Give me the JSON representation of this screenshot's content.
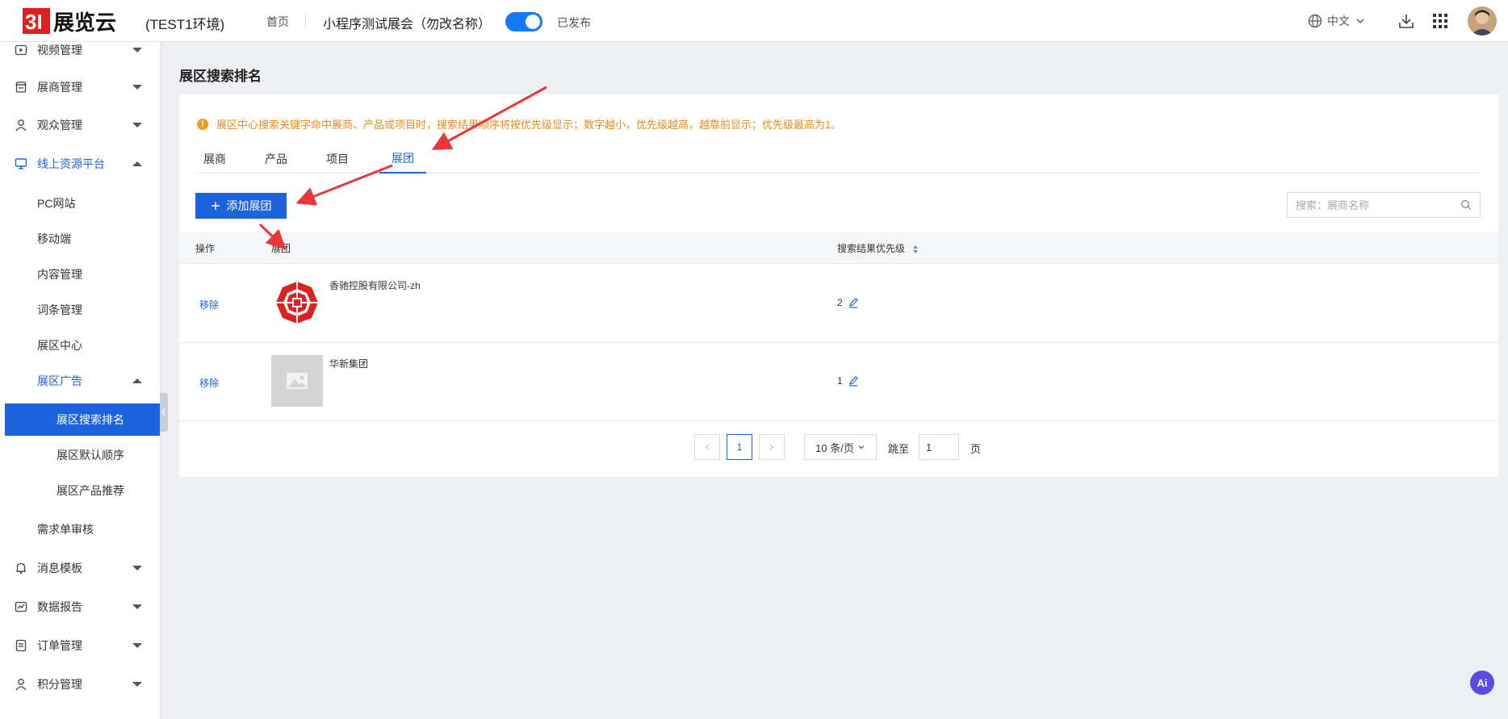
{
  "header": {
    "logo_text": "3I展览云",
    "env_label": "(TEST1环境)",
    "home_label": "首页",
    "expo_name": "小程序测试展会（勿改名称）",
    "publish_status": "已发布",
    "language": "中文"
  },
  "sidebar": {
    "items": [
      {
        "label": "视频管理",
        "icon": "video-icon",
        "state": "collapsed"
      },
      {
        "label": "展商管理",
        "icon": "shop-icon",
        "state": "collapsed"
      },
      {
        "label": "观众管理",
        "icon": "user-icon",
        "state": "collapsed"
      },
      {
        "label": "线上资源平台",
        "icon": "monitor-icon",
        "state": "expanded"
      },
      {
        "label": "PC网站"
      },
      {
        "label": "移动端"
      },
      {
        "label": "内容管理"
      },
      {
        "label": "词条管理"
      },
      {
        "label": "展区中心"
      },
      {
        "label": "展区广告",
        "state": "expanded"
      },
      {
        "label": "展区搜索排名",
        "selected": true
      },
      {
        "label": "展区默认顺序"
      },
      {
        "label": "展区产品推荐"
      },
      {
        "label": "需求单审核"
      },
      {
        "label": "消息模板",
        "icon": "bell-icon",
        "state": "collapsed"
      },
      {
        "label": "数据报告",
        "icon": "chart-icon",
        "state": "collapsed"
      },
      {
        "label": "订单管理",
        "icon": "order-icon",
        "state": "collapsed"
      },
      {
        "label": "积分管理",
        "icon": "points-icon",
        "state": "collapsed"
      }
    ]
  },
  "main": {
    "page_title": "展区搜索排名",
    "notice": "展区中心搜索关键字命中展商、产品或项目时，搜索结果顺序将按优先级显示；数字越小，优先级越高，越靠前显示；优先级最高为1。",
    "tabs": [
      {
        "label": "展商"
      },
      {
        "label": "产品"
      },
      {
        "label": "项目"
      },
      {
        "label": "展团",
        "active": true
      }
    ],
    "add_button": "添加展团",
    "search_placeholder": "搜索：展商名称",
    "table": {
      "columns": [
        "操作",
        "展团",
        "搜索结果优先级"
      ],
      "rows": [
        {
          "action": "移除",
          "name": "香驰控股有限公司-zh",
          "priority": "2",
          "thumb": "logo"
        },
        {
          "action": "移除",
          "name": "华新集团",
          "priority": "1",
          "thumb": "placeholder"
        }
      ]
    },
    "pagination": {
      "current_page": "1",
      "page_size": "10 条/页",
      "jump_label": "跳至",
      "jump_value": "1",
      "page_suffix": "页"
    }
  },
  "ai_badge": "Ai",
  "colors": {
    "accent": "#1d63e0",
    "notice": "#f08a1a",
    "annotation_arrow": "#e8363a",
    "logo_red": "#e02020"
  }
}
